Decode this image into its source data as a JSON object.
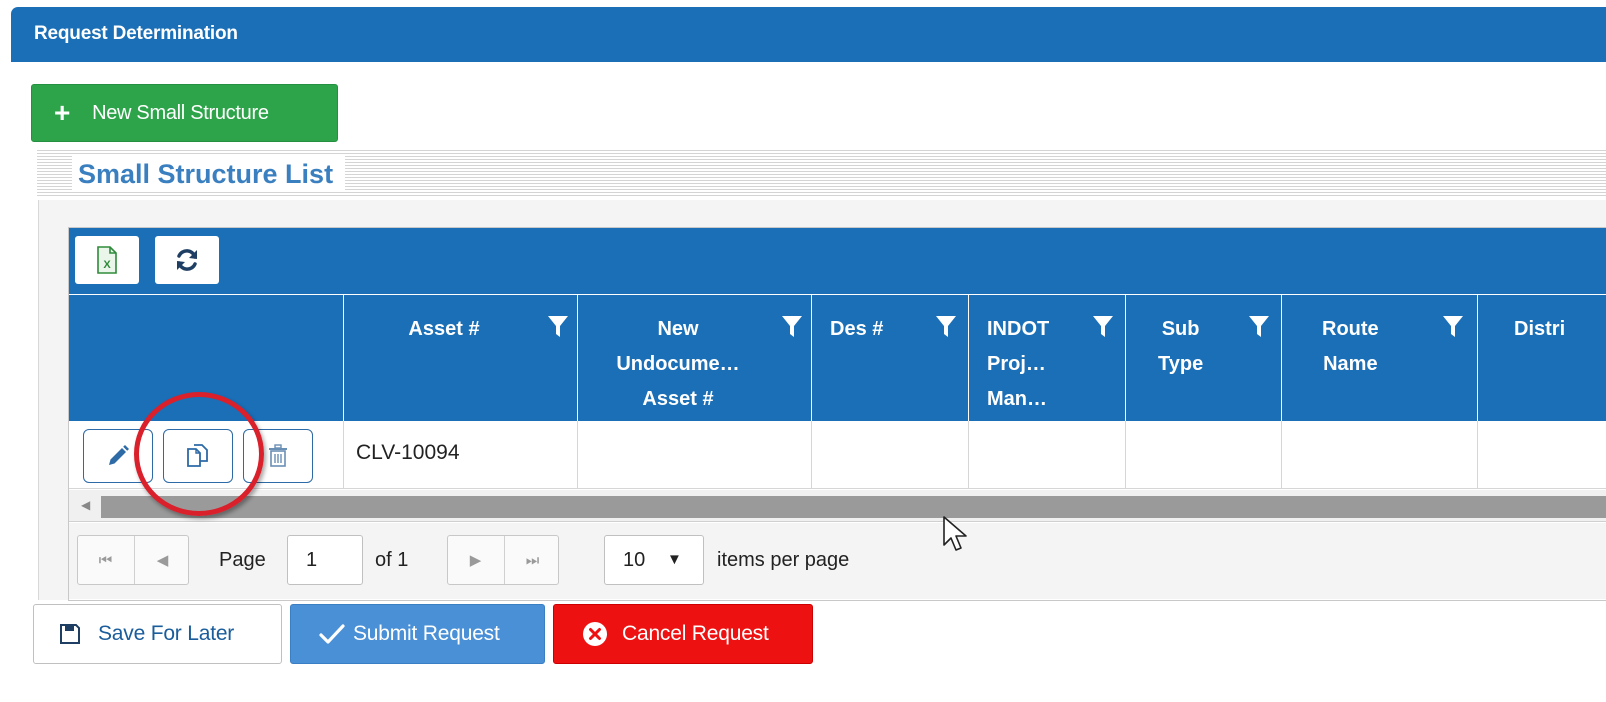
{
  "header": {
    "title": "Request Determination"
  },
  "new_button": {
    "label": "New Small Structure"
  },
  "section": {
    "title": "Small Structure List"
  },
  "grid": {
    "columns": [
      {
        "label": "Asset #"
      },
      {
        "label": "New Undocume… Asset #"
      },
      {
        "label": "Des #"
      },
      {
        "label": "INDOT Proj… Man…"
      },
      {
        "label": "Sub Type"
      },
      {
        "label": "Route Name"
      },
      {
        "label": "Distri"
      }
    ],
    "header_lines": {
      "asset": [
        "Asset #"
      ],
      "new_undoc": [
        "New",
        "Undocume…",
        "Asset #"
      ],
      "des": [
        "Des #"
      ],
      "indot": [
        "INDOT",
        "Proj…",
        "Man…"
      ],
      "subtype": [
        "Sub",
        "Type"
      ],
      "route": [
        "Route",
        "Name"
      ],
      "district": [
        "Distri"
      ]
    },
    "rows": [
      {
        "asset": "CLV-10094",
        "new_undoc": "",
        "des": "",
        "indot": "",
        "subtype": "",
        "route": "",
        "district": ""
      }
    ]
  },
  "pager": {
    "page_label": "Page",
    "page_value": "1",
    "of_label": "of 1",
    "page_size": "10",
    "items_per_page_label": "items per page"
  },
  "actions": {
    "save_label": "Save For Later",
    "submit_label": "Submit Request",
    "cancel_label": "Cancel Request"
  },
  "colors": {
    "header_blue": "#1a6fb7",
    "new_green": "#2ea44a",
    "submit_blue": "#4a90d6",
    "cancel_red": "#ee1111",
    "annotation_red": "#d9202b"
  },
  "icons": [
    "plus-icon",
    "excel-export-icon",
    "refresh-icon",
    "filter-icon",
    "edit-pencil-icon",
    "copy-icon",
    "trash-icon",
    "first-page-icon",
    "prev-page-icon",
    "next-page-icon",
    "last-page-icon",
    "dropdown-arrow-icon",
    "save-floppy-icon",
    "check-icon",
    "cancel-x-icon",
    "mouse-cursor-icon"
  ]
}
